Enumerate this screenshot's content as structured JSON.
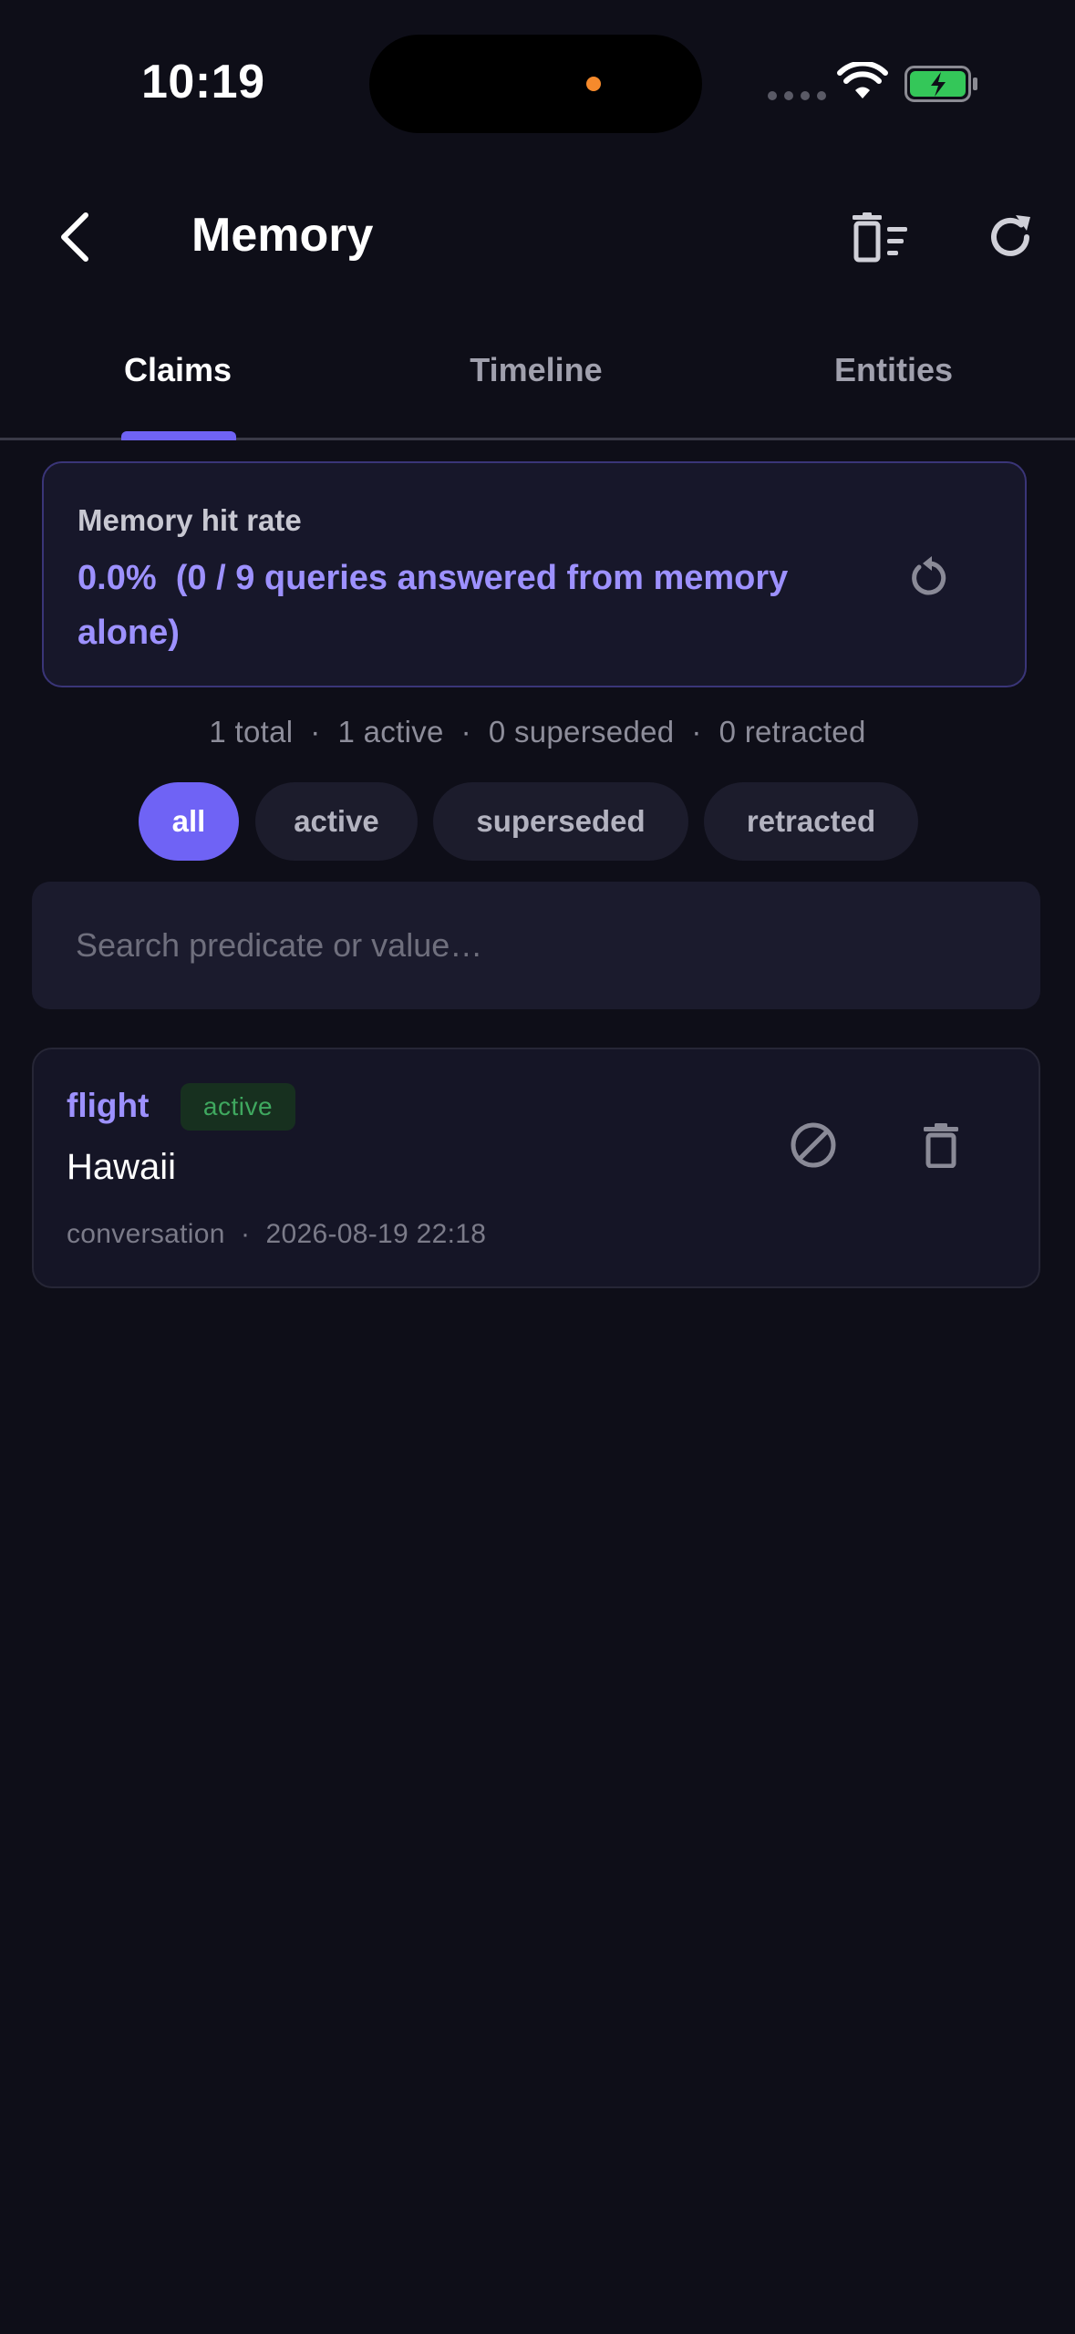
{
  "status_bar": {
    "time": "10:19",
    "icons": [
      "cellular-dots-icon",
      "wifi-icon",
      "battery-charging-icon"
    ]
  },
  "header": {
    "title": "Memory",
    "back_icon": "chevron-left-icon",
    "clear_icon": "delete-sweep-icon",
    "refresh_icon": "refresh-icon"
  },
  "tabs": [
    {
      "label": "Claims",
      "active": true
    },
    {
      "label": "Timeline",
      "active": false
    },
    {
      "label": "Entities",
      "active": false
    }
  ],
  "hit_rate": {
    "label": "Memory hit rate",
    "value": "0.0%  (0 / 9 queries answered from memory alone)",
    "reset_icon": "reset-icon"
  },
  "summary": "1 total  ·  1 active  ·  0 superseded  ·  0 retracted",
  "filters": [
    {
      "label": "all",
      "selected": true
    },
    {
      "label": "active",
      "selected": false
    },
    {
      "label": "superseded",
      "selected": false
    },
    {
      "label": "retracted",
      "selected": false
    }
  ],
  "search": {
    "placeholder": "Search predicate or value…",
    "value": ""
  },
  "claims": [
    {
      "predicate": "flight",
      "status": "active",
      "value": "Hawaii",
      "meta": "conversation  ·  2026-08-19 22:18"
    }
  ],
  "colors": {
    "background": "#0e0e18",
    "accent": "#6f63f5",
    "accent_text": "#9d91ff",
    "active_badge_text": "#3fa85f"
  }
}
